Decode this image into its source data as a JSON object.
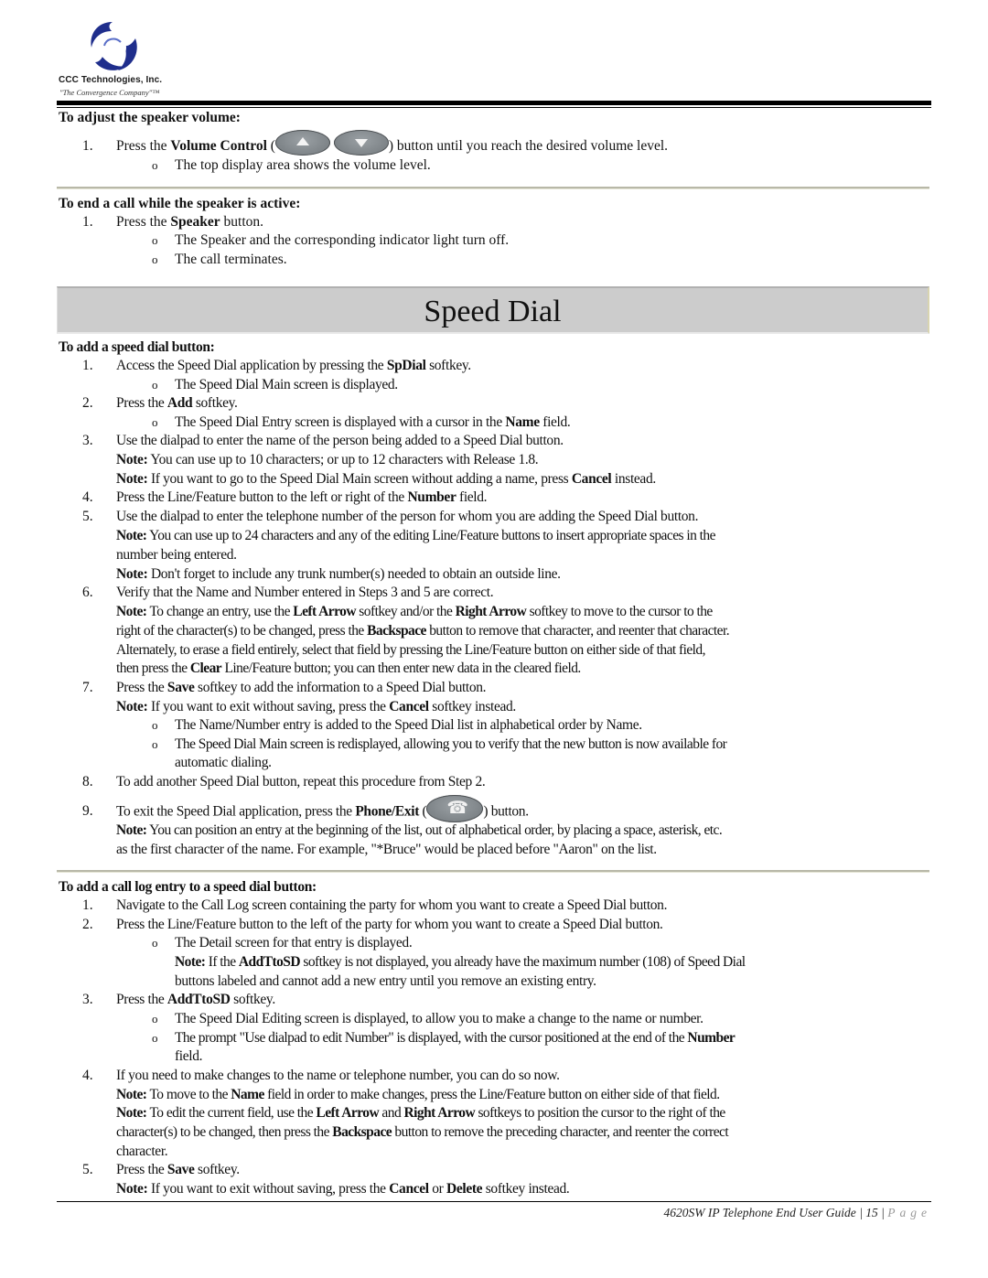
{
  "header": {
    "company": "CCC Technologies, Inc.",
    "tagline": "\"The Convergence Company\"™"
  },
  "volume": {
    "heading": "To adjust the speaker volume:",
    "step1_pre": "Press the ",
    "step1_bold": "Volume Control",
    "step1_paren_open": " (",
    "step1_post": ") button until you reach the desired volume level.",
    "step1_sub": "The top display area shows the volume level.",
    "icons": [
      "volume-up-button",
      "volume-down-button"
    ]
  },
  "end_call": {
    "heading": "To end a call while the speaker is active:",
    "step1_pre": "Press the ",
    "step1_bold": "Speaker",
    "step1_post": " button.",
    "subs": [
      "The Speaker and the corresponding indicator light turn off.",
      "The call terminates."
    ]
  },
  "banner": {
    "title": "Speed Dial"
  },
  "add_speed_dial": {
    "heading": "To add a speed dial button:",
    "s1": {
      "pre": "Access the Speed Dial application by pressing the ",
      "b": "SpDial",
      "post": " softkey.",
      "sub": "The Speed Dial Main screen is displayed."
    },
    "s2": {
      "pre": "Press the ",
      "b": "Add",
      "post": " softkey.",
      "sub_pre": "The Speed Dial Entry screen is displayed with a cursor in the ",
      "sub_b": "Name",
      "sub_post": " field."
    },
    "s3": {
      "text": "Use the dialpad to enter the name of the person being added to a Speed Dial button.",
      "note1": "You can use up to 10 characters; or up to 12 characters with Release 1.8.",
      "note2_pre": "If you want to go to the Speed Dial Main screen without adding a name, press ",
      "note2_b": "Cancel",
      "note2_post": " instead."
    },
    "s4": {
      "pre": "Press the Line/Feature button to the left or right of the ",
      "b": "Number",
      "post": " field."
    },
    "s5": {
      "text": "Use the dialpad to enter the telephone number of the person for whom you are adding the Speed Dial button.",
      "note1_l1": "You can use up to 24 characters and any of the editing Line/Feature buttons to insert appropriate spaces in the",
      "note1_l2": "number being entered.",
      "note2": "Don't forget to include any trunk number(s) needed to obtain an outside line."
    },
    "s6": {
      "text": "Verify that the Name and Number entered in Steps 3 and 5 are correct.",
      "note_l1_a": "To change an entry, use the ",
      "note_l1_b1": "Left Arrow",
      "note_l1_c": " softkey and/or the ",
      "note_l1_b2": "Right Arrow",
      "note_l1_d": " softkey to move to the cursor to the",
      "note_l2_a": "right of the character(s) to be changed, press the ",
      "note_l2_b": "Backspace",
      "note_l2_c": " button to remove that character, and reenter that character.",
      "note_l3": "Alternately, to erase a field entirely, select that field by pressing the Line/Feature button on either side of that field,",
      "note_l4_a": "then press the ",
      "note_l4_b": "Clear",
      "note_l4_c": " Line/Feature button; you can then enter new data in the cleared field."
    },
    "s7": {
      "pre": "Press the ",
      "b": "Save",
      "post": " softkey to add the information to a Speed Dial button.",
      "note_pre": "If you want to exit without saving, press the ",
      "note_b": "Cancel",
      "note_post": " softkey instead.",
      "sub1": "The Name/Number entry is added to the Speed Dial list in alphabetical order by Name.",
      "sub2_l1": "The Speed Dial Main screen is redisplayed, allowing you to verify that the new button is now available for",
      "sub2_l2": "automatic dialing."
    },
    "s8": {
      "text": "To add another Speed Dial button, repeat this procedure from Step 2."
    },
    "s9": {
      "pre": "To exit the Speed Dial application, press the ",
      "b": "Phone/Exit",
      "paren_open": " (",
      "post": ") button.",
      "note_l1": "You can position an entry at the beginning of the list, out of alphabetical order, by placing a space, asterisk, etc.",
      "note_l2": "as the first character of the name. For example, \"*Bruce\" would be placed before \"Aaron\" on the list."
    }
  },
  "call_log": {
    "heading": "To add a call log entry to a speed dial button:",
    "s1": "Navigate to the Call Log screen containing the party for whom you want to create a Speed Dial button.",
    "s2": "Press the Line/Feature button to the left of the party for whom you want to create a Speed Dial button.",
    "s2_sub": "The Detail screen for that entry is displayed.",
    "s2_note_l1_a": "If the ",
    "s2_note_l1_b": "AddTtoSD",
    "s2_note_l1_c": " softkey is not displayed, you already have the maximum number (108) of Speed Dial",
    "s2_note_l2": "buttons labeled and cannot add a new entry until you remove an existing entry.",
    "s3_pre": "Press the ",
    "s3_b": "AddTtoSD",
    "s3_post": " softkey.",
    "s3_sub1": "The Speed Dial Editing screen is displayed, to allow you to make a change to the name or number.",
    "s3_sub2_l1_a": "The prompt \"Use dialpad to edit Number\" is displayed, with the cursor positioned at the end of the ",
    "s3_sub2_l1_b": "Number",
    "s3_sub2_l2": "field.",
    "s4": "If you need to make changes to the name or telephone number, you can do so now.",
    "s4_note1_a": "To move to the ",
    "s4_note1_b": "Name",
    "s4_note1_c": " field in order to make changes, press the Line/Feature button on either side of that field.",
    "s4_note2_l1_a": "To edit the current field, use the ",
    "s4_note2_l1_b1": "Left Arrow",
    "s4_note2_l1_c": " and ",
    "s4_note2_l1_b2": "Right Arrow",
    "s4_note2_l1_d": " softkeys to position the cursor to the right of the",
    "s4_note2_l2_a": "character(s) to be changed, then press the ",
    "s4_note2_l2_b": "Backspace",
    "s4_note2_l2_c": " button to remove the preceding character, and reenter the correct",
    "s4_note2_l3": "character.",
    "s5_pre": "Press the ",
    "s5_b": "Save",
    "s5_post": " softkey.",
    "s5_note_a": "If you want to exit without saving, press the ",
    "s5_note_b1": "Cancel",
    "s5_note_c": " or ",
    "s5_note_b2": "Delete",
    "s5_note_d": " softkey instead."
  },
  "labels": {
    "note": "Note:",
    "bullet": "o",
    "n1": "1.",
    "n2": "2.",
    "n3": "3.",
    "n4": "4.",
    "n5": "5.",
    "n6": "6.",
    "n7": "7.",
    "n8": "8.",
    "n9": "9."
  },
  "footer": {
    "guide": "4620SW IP Telephone End User Guide",
    "sep": " | ",
    "page_number": "15",
    "page_word": "Page"
  }
}
